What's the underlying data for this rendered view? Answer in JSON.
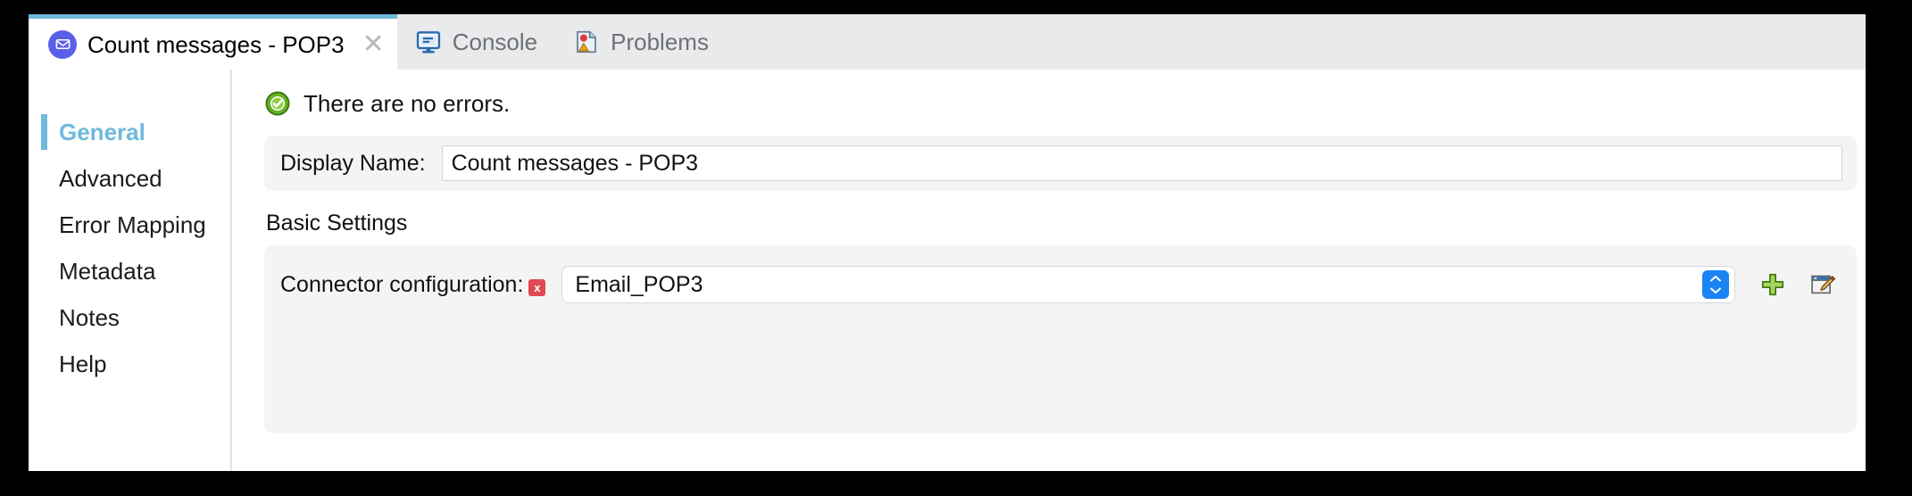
{
  "colors": {
    "accent_blue": "#6fb9dd",
    "tabbar_bg": "#e8eaec",
    "panel_bg": "#f4f4f4",
    "error_red": "#e04a55",
    "stepper_blue": "#1a84f5",
    "plus_green": "#8cc63f",
    "envelope_purple": "#5b5fe8"
  },
  "tabs": [
    {
      "label": "Count messages - POP3",
      "icon": "envelope-icon",
      "active": true,
      "closable": true,
      "close_label": "✕"
    },
    {
      "label": "Console",
      "icon": "console-monitor-icon",
      "active": false,
      "closable": false
    },
    {
      "label": "Problems",
      "icon": "problems-page-icon",
      "active": false,
      "closable": false
    }
  ],
  "sidebar": {
    "items": [
      {
        "label": "General",
        "selected": true
      },
      {
        "label": "Advanced",
        "selected": false
      },
      {
        "label": "Error Mapping",
        "selected": false
      },
      {
        "label": "Metadata",
        "selected": false
      },
      {
        "label": "Notes",
        "selected": false
      },
      {
        "label": "Help",
        "selected": false
      }
    ]
  },
  "content": {
    "status": {
      "icon": "success-check-icon",
      "text": "There are no errors."
    },
    "display_name": {
      "label": "Display Name:",
      "value": "Count messages - POP3",
      "placeholder": ""
    },
    "section_title": "Basic Settings",
    "connector": {
      "label": "Connector configuration:",
      "error_marker": "x",
      "value": "Email_POP3",
      "options": [
        "Email_POP3"
      ],
      "stepper_icon": "up-down-chevron-icon",
      "add_button_icon": "plus-icon",
      "edit_button_icon": "edit-pencil-icon"
    }
  }
}
